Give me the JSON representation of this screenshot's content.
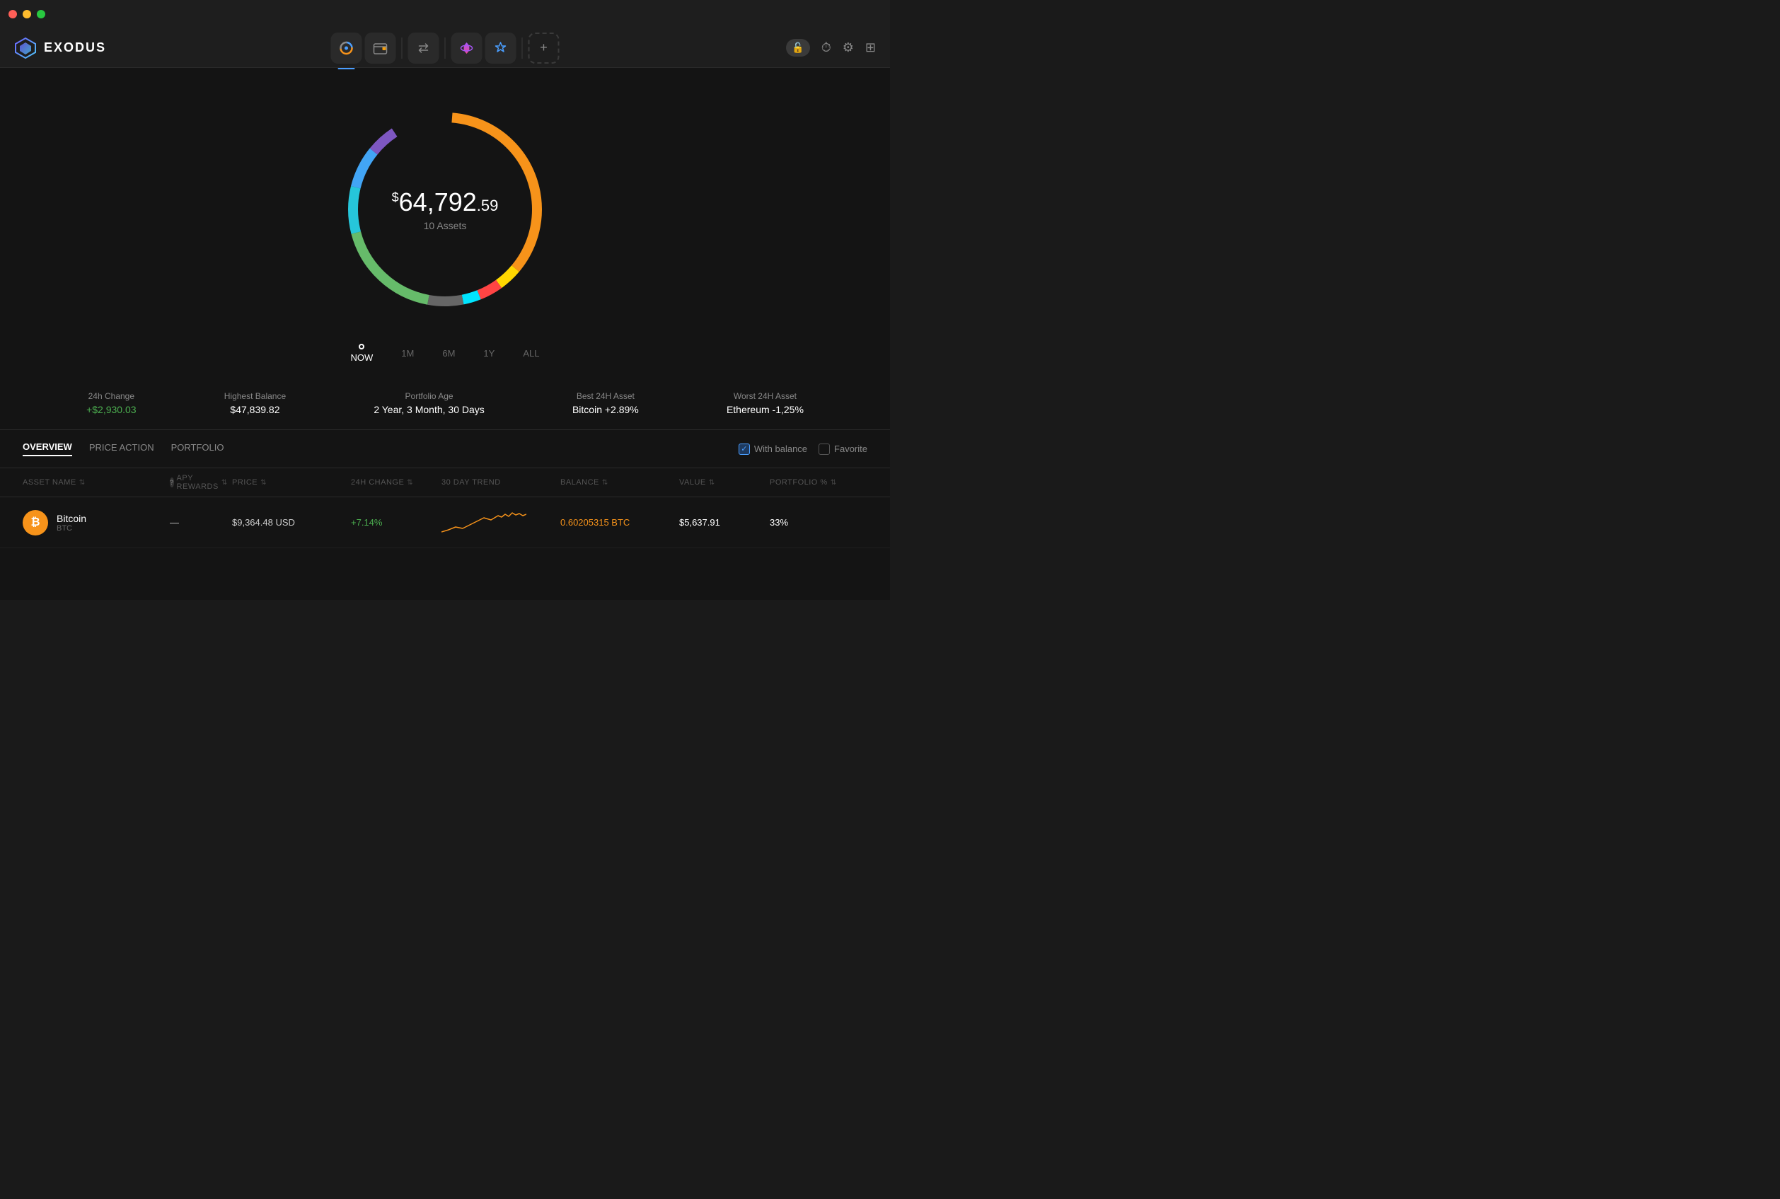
{
  "titlebar": {
    "buttons": [
      "close",
      "minimize",
      "maximize"
    ]
  },
  "header": {
    "logo_text": "EXODUS",
    "nav_items": [
      {
        "id": "portfolio",
        "label": "Portfolio",
        "active": true
      },
      {
        "id": "wallet",
        "label": "Wallet"
      },
      {
        "id": "exchange",
        "label": "Exchange"
      },
      {
        "id": "apps",
        "label": "Apps"
      },
      {
        "id": "earn",
        "label": "Earn"
      },
      {
        "id": "add",
        "label": "+"
      }
    ],
    "right_items": [
      "lock",
      "history",
      "settings",
      "grid"
    ]
  },
  "portfolio": {
    "amount_prefix": "$",
    "amount_main": "64,792",
    "amount_decimal": ".59",
    "assets_count": "10 Assets"
  },
  "timeline": [
    {
      "label": "NOW",
      "active": true
    },
    {
      "label": "1M",
      "active": false
    },
    {
      "label": "6M",
      "active": false
    },
    {
      "label": "1Y",
      "active": false
    },
    {
      "label": "ALL",
      "active": false
    }
  ],
  "stats": [
    {
      "label": "24h Change",
      "value": "+$2,930.03",
      "positive": true
    },
    {
      "label": "Highest Balance",
      "value": "$47,839.82",
      "positive": false
    },
    {
      "label": "Portfolio Age",
      "value": "2 Year, 3 Month, 30 Days",
      "positive": false
    },
    {
      "label": "Best 24H Asset",
      "value": "Bitcoin +2.89%",
      "positive": false
    },
    {
      "label": "Worst 24H Asset",
      "value": "Ethereum -1,25%",
      "positive": false
    }
  ],
  "tabs": [
    {
      "label": "OVERVIEW",
      "active": true
    },
    {
      "label": "PRICE ACTION",
      "active": false
    },
    {
      "label": "PORTFOLIO",
      "active": false
    }
  ],
  "filters": [
    {
      "label": "With balance",
      "checked": true
    },
    {
      "label": "Favorite",
      "checked": false
    }
  ],
  "table": {
    "headers": [
      {
        "label": "ASSET NAME",
        "sortable": true
      },
      {
        "label": "?",
        "sublabel": "APY REWARDS",
        "sortable": true
      },
      {
        "label": "PRICE",
        "sortable": true
      },
      {
        "label": "24H CHANGE",
        "sortable": true
      },
      {
        "label": "30 DAY TREND",
        "sortable": false
      },
      {
        "label": "BALANCE",
        "sortable": true
      },
      {
        "label": "VALUE",
        "sortable": true
      },
      {
        "label": "PORTFOLIO %",
        "sortable": true
      }
    ],
    "rows": [
      {
        "name": "Bitcoin",
        "ticker": "BTC",
        "icon_color": "#f7931a",
        "icon_text": "₿",
        "price": "$9,364.48 USD",
        "change": "+7.14%",
        "change_positive": true,
        "balance": "0.60205315 BTC",
        "value": "$5,637.91",
        "portfolio": "33%"
      }
    ]
  },
  "donut": {
    "segments": [
      {
        "color": "#f7931a",
        "percent": 35,
        "label": "Bitcoin"
      },
      {
        "color": "#ffd700",
        "percent": 12,
        "label": "Gold"
      },
      {
        "color": "#ff4444",
        "percent": 5,
        "label": "Red"
      },
      {
        "color": "#00e5ff",
        "percent": 4,
        "label": "Cyan"
      },
      {
        "color": "#888",
        "percent": 6,
        "label": "Gray"
      },
      {
        "color": "#66bb6a",
        "percent": 18,
        "label": "Green"
      },
      {
        "color": "#26c6da",
        "percent": 8,
        "label": "Teal"
      },
      {
        "color": "#42a5f5",
        "percent": 7,
        "label": "Blue"
      },
      {
        "color": "#7e57c2",
        "percent": 5,
        "label": "Purple"
      }
    ]
  }
}
